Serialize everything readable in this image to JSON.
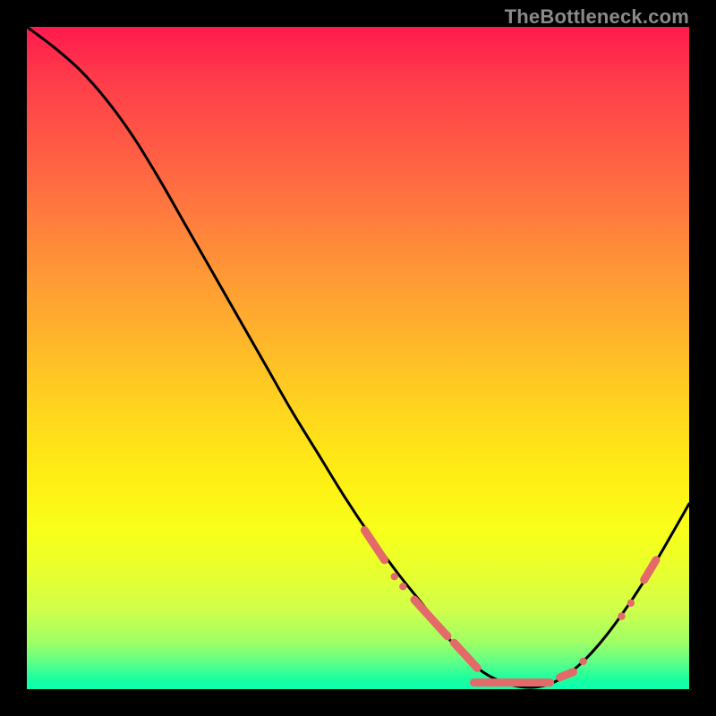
{
  "watermark": "TheBottleneck.com",
  "colors": {
    "background": "#000000",
    "curve": "#000000",
    "marker": "#e46a6a",
    "watermark": "#8a8a8a"
  },
  "chart_data": {
    "type": "line",
    "title": "",
    "xlabel": "",
    "ylabel": "",
    "xlim": [
      0,
      100
    ],
    "ylim": [
      0,
      100
    ],
    "grid": false,
    "legend": false,
    "series": [
      {
        "name": "bottleneck-curve",
        "x": [
          0,
          4,
          8,
          12,
          16,
          20,
          24,
          28,
          32,
          36,
          40,
          44,
          48,
          52,
          56,
          60,
          63,
          66,
          69,
          72,
          75,
          78,
          81,
          84,
          87,
          90,
          93,
          96,
          100
        ],
        "y": [
          100,
          97,
          93.5,
          89,
          83.5,
          77,
          70,
          63,
          56,
          49,
          42,
          35.5,
          29,
          23,
          17.5,
          12.5,
          8.5,
          5,
          2.5,
          1,
          0.3,
          0.5,
          1.8,
          4.2,
          7.5,
          11.5,
          16,
          21,
          28
        ]
      }
    ],
    "markers": [
      {
        "mode": "segment",
        "x0": 51,
        "x1": 54,
        "y0": 24.0,
        "y1": 19.5,
        "width": 9
      },
      {
        "mode": "point",
        "x": 55.5,
        "y": 17.0,
        "r": 4.2
      },
      {
        "mode": "point",
        "x": 56.8,
        "y": 15.5,
        "r": 4.2
      },
      {
        "mode": "segment",
        "x0": 58.5,
        "x1": 63.5,
        "y0": 13.5,
        "y1": 8.0,
        "width": 9
      },
      {
        "mode": "segment",
        "x0": 64.5,
        "x1": 68.0,
        "y0": 7.0,
        "y1": 3.2,
        "width": 9
      },
      {
        "mode": "segment",
        "x0": 67.5,
        "x1": 79.0,
        "y0": 1.0,
        "y1": 1.0,
        "width": 9
      },
      {
        "mode": "point",
        "x": 79.0,
        "y": 1.0,
        "r": 4.2
      },
      {
        "mode": "segment",
        "x0": 80.5,
        "x1": 82.5,
        "y0": 1.8,
        "y1": 2.6,
        "width": 9
      },
      {
        "mode": "point",
        "x": 84.0,
        "y": 4.2,
        "r": 4.2
      },
      {
        "mode": "point",
        "x": 89.8,
        "y": 11.0,
        "r": 4.2
      },
      {
        "mode": "point",
        "x": 91.2,
        "y": 13.0,
        "r": 4.2
      },
      {
        "mode": "segment",
        "x0": 93.2,
        "x1": 95.0,
        "y0": 16.5,
        "y1": 19.5,
        "width": 9
      }
    ]
  }
}
